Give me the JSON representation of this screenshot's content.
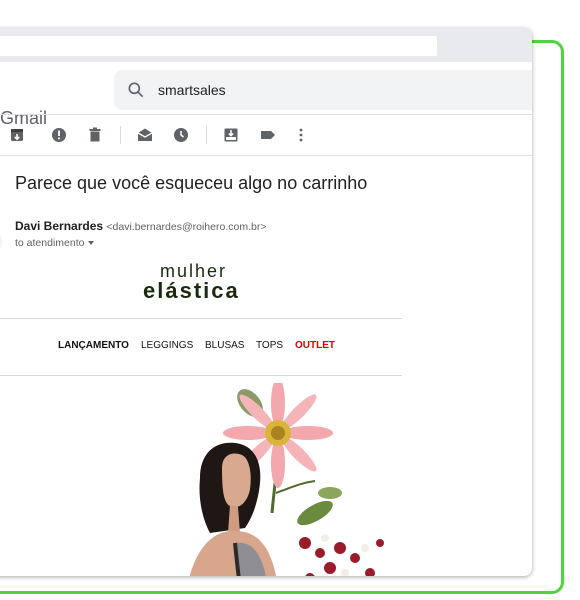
{
  "browser": {
    "url": ""
  },
  "gmail": {
    "logo_text": "Gmail"
  },
  "search": {
    "value": "smartsales"
  },
  "toolbar": {
    "icons": [
      "archive-icon",
      "report-spam-icon",
      "delete-icon",
      "mark-unread-icon",
      "snooze-icon",
      "move-to-icon",
      "label-icon",
      "more-icon"
    ]
  },
  "email": {
    "subject": "Parece que você esqueceu algo no carrinho",
    "sender_name": "Davi Bernardes",
    "sender_email": "<davi.bernardes@roihero.com.br>",
    "recipient": "to atendimento"
  },
  "newsletter": {
    "brand_line1": "mulher",
    "brand_line2": "elástica",
    "nav": [
      "LANÇAMENTO",
      "LEGGINGS",
      "BLUSAS",
      "TOPS",
      "OUTLET"
    ]
  },
  "colors": {
    "frame": "#4ed43c",
    "outlet": "#e00000",
    "brand": "#1a2a0e"
  }
}
